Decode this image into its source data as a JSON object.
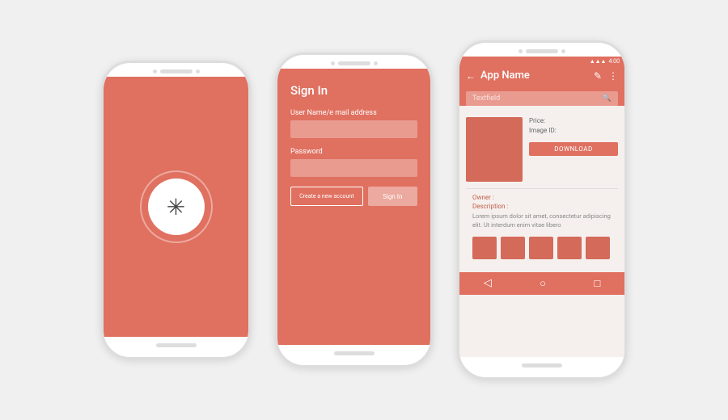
{
  "phone1": {
    "aria": "splash screen"
  },
  "phone2": {
    "title": "Sign In",
    "username_label": "User Name/e mail address",
    "password_label": "Password",
    "create_btn": "Create a new account",
    "signin_btn": "Sign In"
  },
  "phone3": {
    "app_name": "App Name",
    "search_placeholder": "Textfield",
    "price_label": "Price:",
    "image_id_label": "Image ID:",
    "download_btn": "DOWNLOAD",
    "owner_label": "Owner :",
    "description_label": "Description :",
    "description_text": "Lorem ipsum dolor sit amet, consectetur adipiscing elit. Ut interdum enim vitae libero",
    "status_time": "4:00",
    "status_signal": "▲▲▲",
    "status_battery": "■"
  }
}
